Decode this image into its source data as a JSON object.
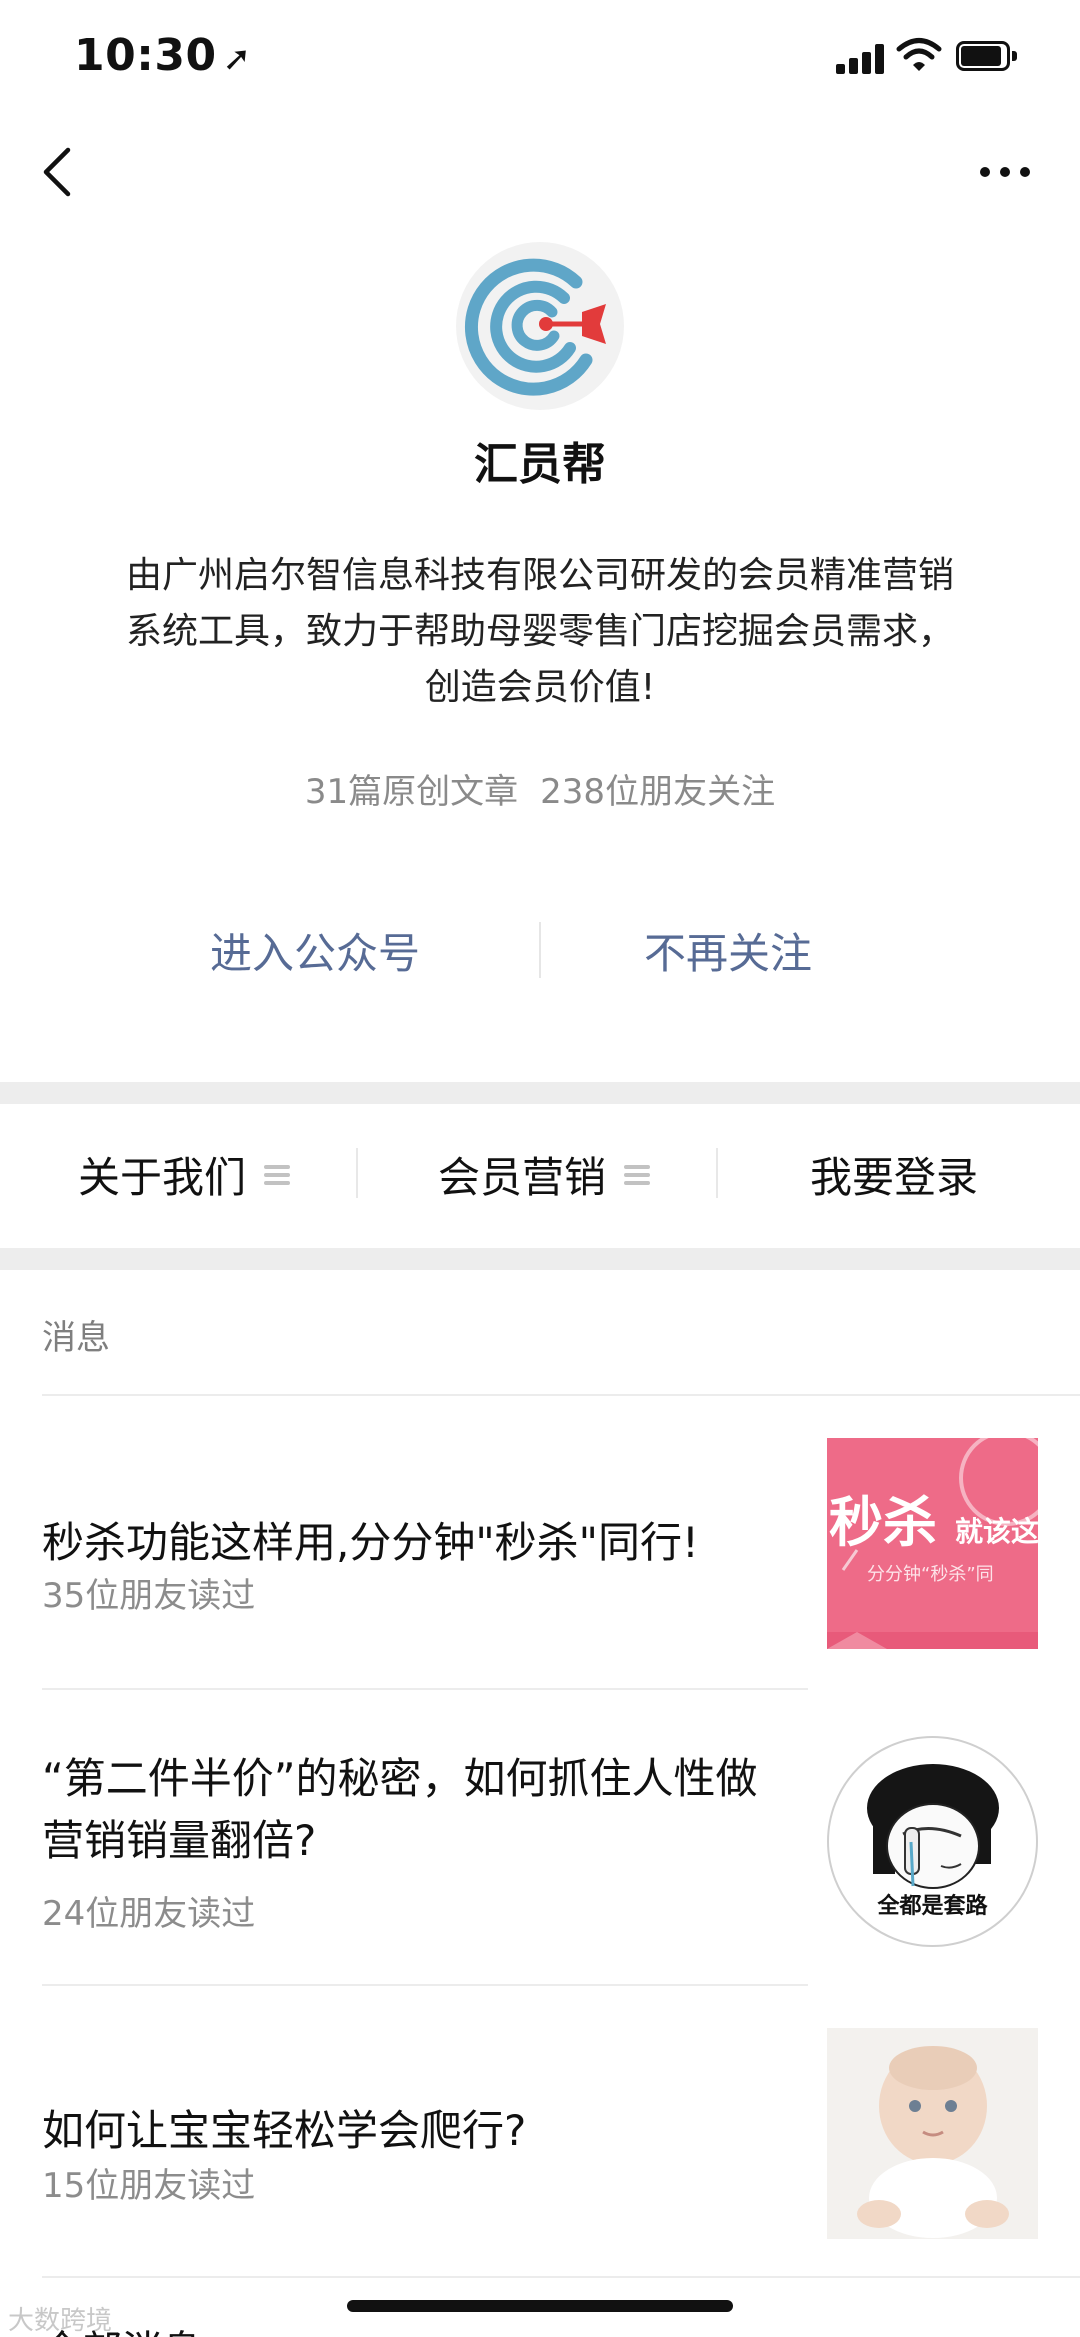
{
  "status_bar": {
    "time": "10:30",
    "location_icon": "location-arrow-icon",
    "icons": [
      "signal-icon",
      "wifi-icon",
      "battery-icon"
    ]
  },
  "nav": {
    "back_icon": "chevron-left-icon",
    "more_icon": "more-dots-icon"
  },
  "profile": {
    "name": "汇员帮",
    "description": "由广州启尔智信息科技有限公司研发的会员精准营销系统工具，致力于帮助母婴零售门店挖掘会员需求，创造会员价值!",
    "stats": {
      "articles": "31篇原创文章",
      "followers": "238位朋友关注"
    },
    "enter_label": "进入公众号",
    "unfollow_label": "不再关注"
  },
  "menu": {
    "items": [
      {
        "label": "关于我们",
        "has_submenu": true
      },
      {
        "label": "会员营销",
        "has_submenu": true
      },
      {
        "label": "我要登录",
        "has_submenu": false
      }
    ]
  },
  "messages": {
    "section_label": "消息",
    "articles": [
      {
        "title": "秒杀功能这样用,分分钟\"秒杀\"同行!",
        "reads": "35位朋友读过",
        "thumb": {
          "big": "秒杀",
          "small": "就该这",
          "sub": "分分钟“秒杀”同"
        }
      },
      {
        "title": "“第二件半价”的秘密，如何抓住人性做营销销量翻倍?",
        "reads": "24位朋友读过",
        "thumb": {
          "caption": "全都是套路"
        }
      },
      {
        "title": "如何让宝宝轻松学会爬行?",
        "reads": "15位朋友读过",
        "thumb": {}
      }
    ],
    "next_section_partial": "全部消息"
  },
  "watermark": "大数跨境",
  "colors": {
    "link": "#576b95",
    "thumb_pink": "#ee6b88",
    "avatar_blue": "#5fa6c8",
    "dart_red": "#e23b3b"
  }
}
